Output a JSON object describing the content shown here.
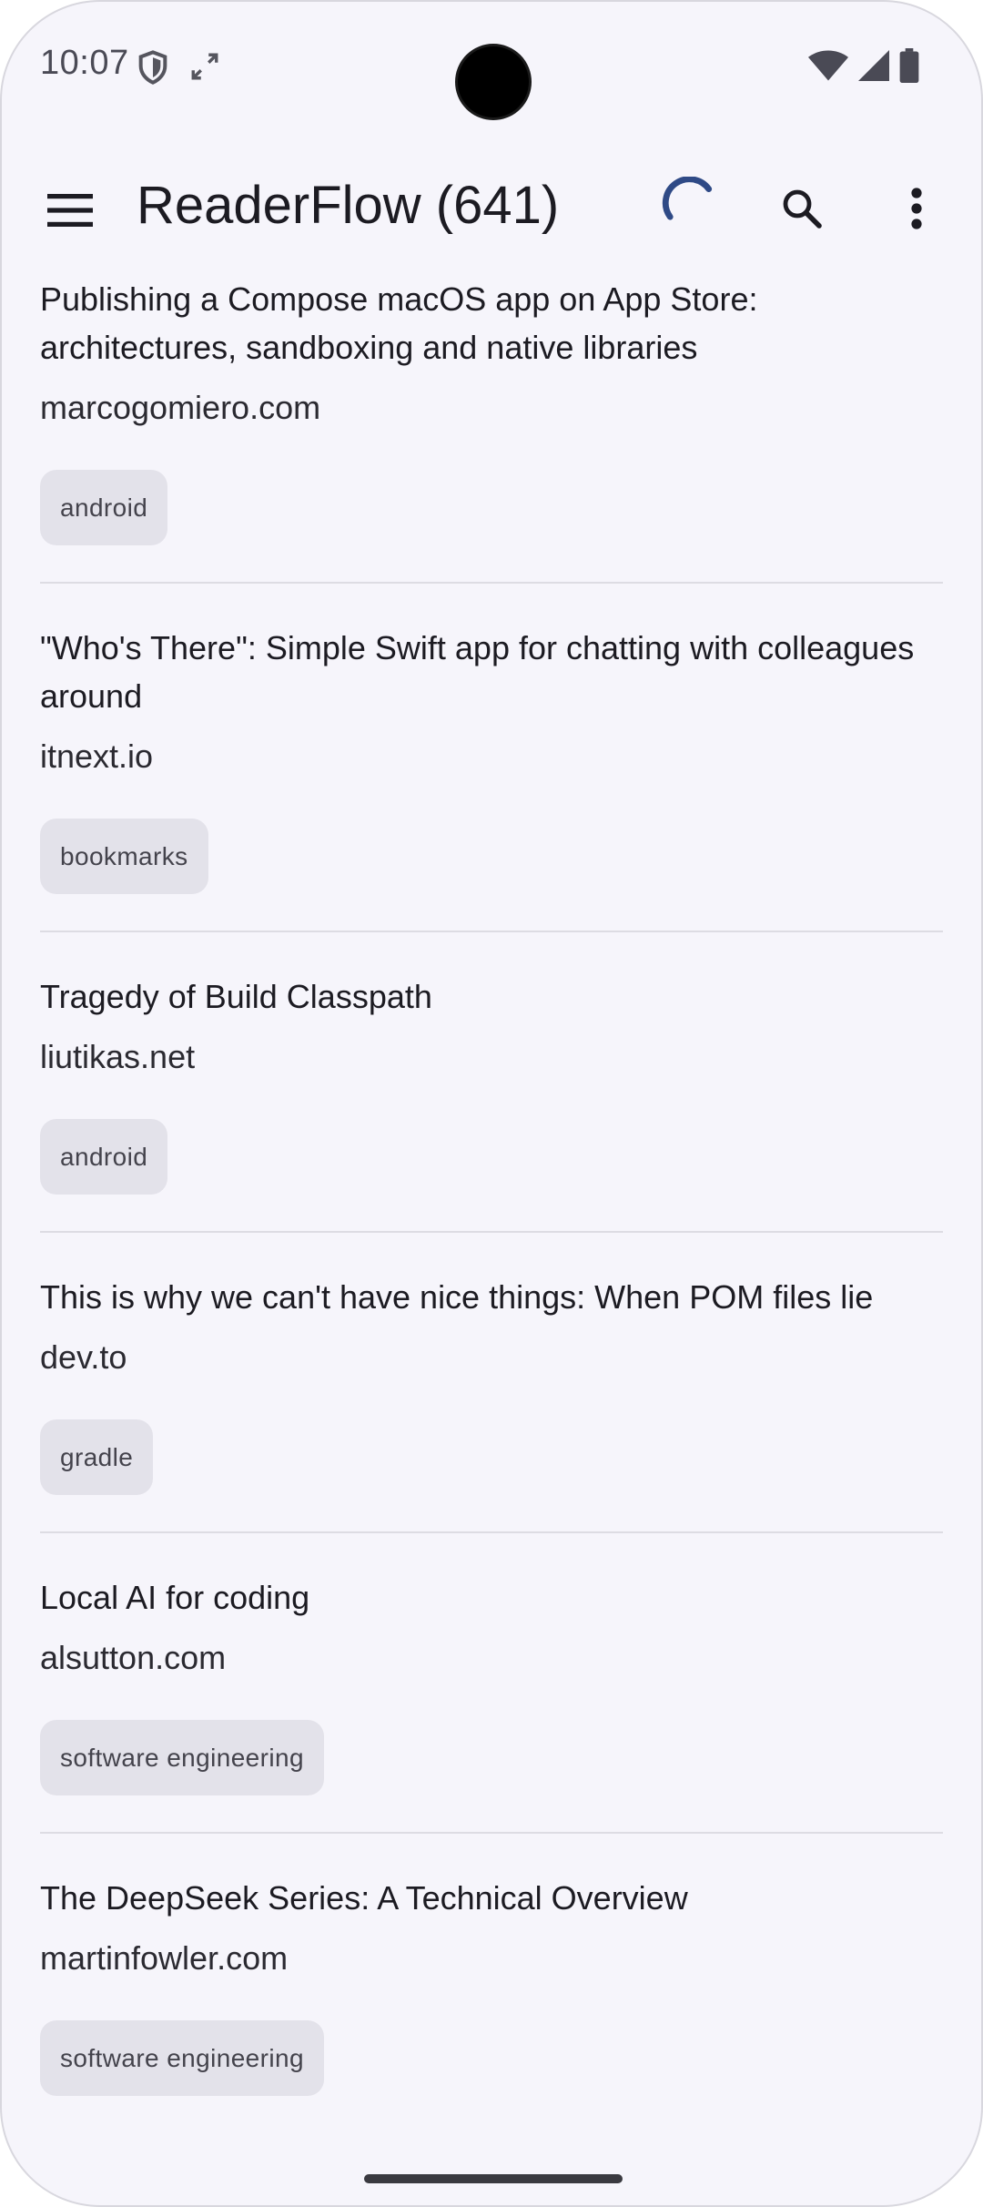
{
  "status_bar": {
    "time": "10:07",
    "icons": [
      "shield-icon",
      "sync-icon",
      "wifi-icon",
      "signal-icon",
      "battery-icon"
    ]
  },
  "app_bar": {
    "title": "ReaderFlow (641)",
    "icons": [
      "menu-icon",
      "loading-spinner",
      "search-icon",
      "more-vert-icon"
    ]
  },
  "articles": [
    {
      "title": "Publishing a Compose macOS app on App Store: architectures, sandboxing and native libraries",
      "domain": "marcogomiero.com",
      "tag": "android"
    },
    {
      "title": "\"Who's There\": Simple Swift app for chatting with colleagues around",
      "domain": "itnext.io",
      "tag": "bookmarks"
    },
    {
      "title": "Tragedy of Build Classpath",
      "domain": "liutikas.net",
      "tag": "android"
    },
    {
      "title": "This is why we can't have nice things: When POM files lie",
      "domain": "dev.to",
      "tag": "gradle"
    },
    {
      "title": "Local AI for coding",
      "domain": "alsutton.com",
      "tag": "software engineering"
    },
    {
      "title": "The DeepSeek Series: A Technical Overview",
      "domain": "martinfowler.com",
      "tag": "software engineering"
    }
  ],
  "colors": {
    "background": "#f6f5fb",
    "chip": "#e3e2ea",
    "spinner": "#2f4a86",
    "divider": "#dddce3"
  }
}
